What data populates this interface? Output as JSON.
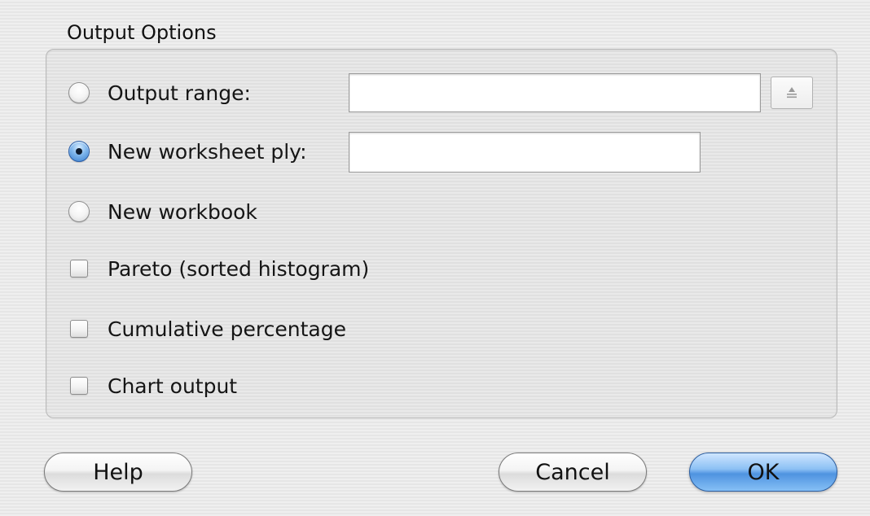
{
  "group": {
    "title": "Output Options"
  },
  "output_range": {
    "label": "Output range:",
    "selected": false,
    "value": ""
  },
  "new_worksheet_ply": {
    "label": "New worksheet ply:",
    "selected": true,
    "value": ""
  },
  "new_workbook": {
    "label": "New workbook",
    "selected": false
  },
  "pareto": {
    "label": "Pareto (sorted histogram)",
    "checked": false
  },
  "cumulative_percentage": {
    "label": "Cumulative percentage",
    "checked": false
  },
  "chart_output": {
    "label": "Chart output",
    "checked": false
  },
  "buttons": {
    "help": "Help",
    "cancel": "Cancel",
    "ok": "OK"
  },
  "icons": {
    "range_selector": "collapse-dialog-icon"
  },
  "colors": {
    "default_button": "#4f93e0",
    "selected_radio": "#3a7fd0"
  }
}
